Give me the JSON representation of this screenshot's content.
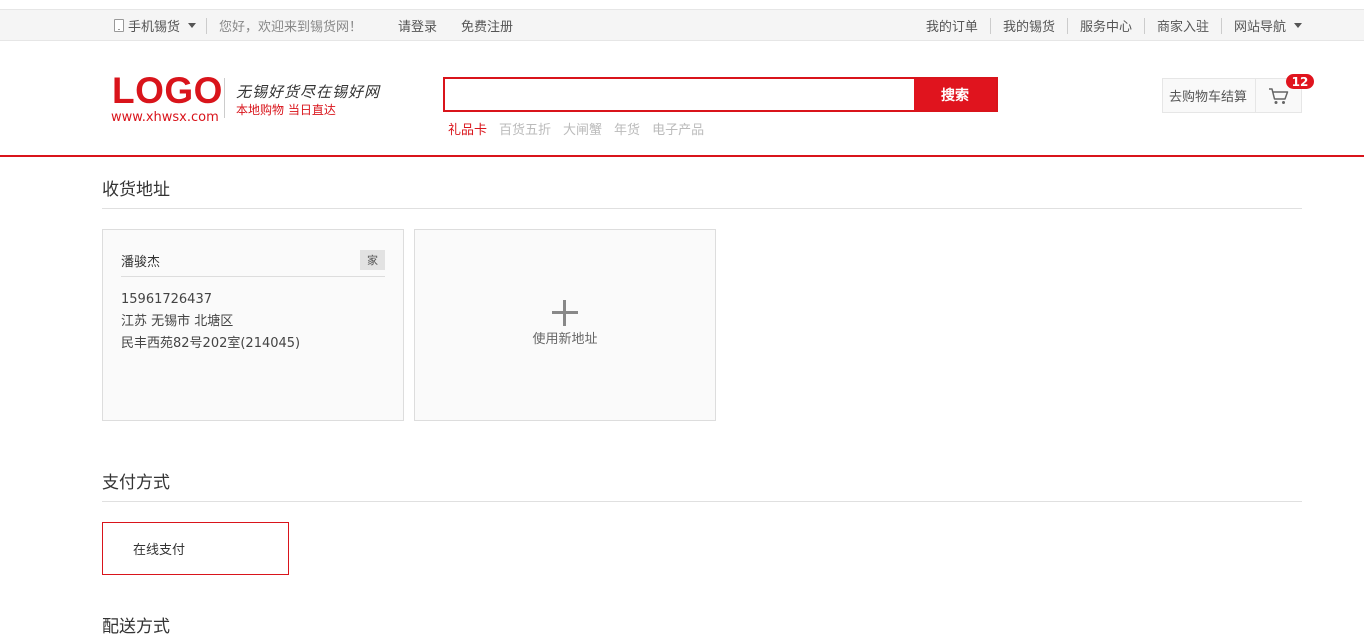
{
  "topbar": {
    "mobile_label": "手机锡货",
    "welcome": "您好，欢迎来到锡货网！",
    "login": "请登录",
    "register": "免费注册",
    "links": [
      "我的订单",
      "我的锡货",
      "服务中心",
      "商家入驻",
      "网站导航"
    ]
  },
  "header": {
    "logo_text": "LOGO",
    "logo_url": "www.xhwsx.com",
    "slogan": "无锡好货尽在锡好网",
    "slogan_sub": "本地购物  当日直达",
    "search_placeholder": "",
    "search_button": "搜索",
    "hot_words": [
      "礼品卡",
      "百货五折",
      "大闸蟹",
      "年货",
      "电子产品"
    ],
    "cart_label": "去购物车结算",
    "cart_count": "12"
  },
  "address": {
    "title": "收货地址",
    "card": {
      "name": "潘骏杰",
      "tag": "家",
      "phone": "15961726437",
      "region": "江苏 无锡市 北塘区",
      "detail": "民丰西苑82号202室(214045)"
    },
    "new_label": "使用新地址"
  },
  "payment": {
    "title": "支付方式",
    "option": "在线支付"
  },
  "delivery": {
    "title": "配送方式"
  },
  "colors": {
    "brand_red": "#d9141b",
    "button_red": "#e0141e"
  }
}
